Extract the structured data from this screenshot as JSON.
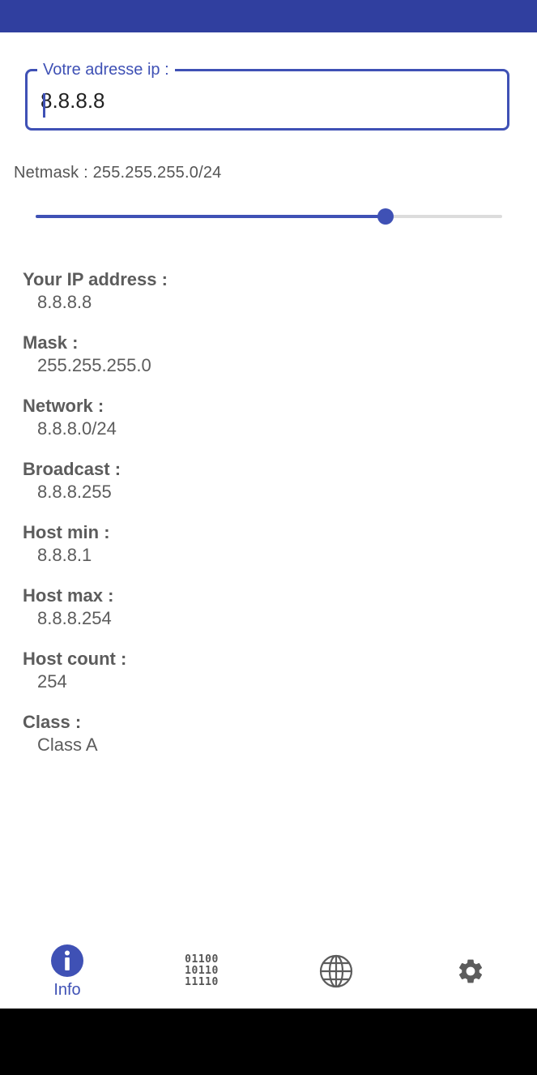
{
  "ip_field": {
    "label": "Votre adresse ip :",
    "value": "8.8.8.8"
  },
  "netmask": {
    "text": "Netmask : 255.255.255.0/24",
    "prefix": 24,
    "min": 0,
    "max": 32
  },
  "info": [
    {
      "label": "Your IP address :",
      "value": "8.8.8.8"
    },
    {
      "label": "Mask :",
      "value": "255.255.255.0"
    },
    {
      "label": "Network :",
      "value": "8.8.8.0/24"
    },
    {
      "label": "Broadcast :",
      "value": "8.8.8.255"
    },
    {
      "label": "Host min :",
      "value": "8.8.8.1"
    },
    {
      "label": "Host max :",
      "value": "8.8.8.254"
    },
    {
      "label": "Host count :",
      "value": "254"
    },
    {
      "label": "Class :",
      "value": "Class A"
    }
  ],
  "nav": {
    "info_label": "Info",
    "binary_icon": {
      "rows": [
        "01100",
        "10110",
        "11110"
      ]
    },
    "icons": [
      "info-icon",
      "binary-icon",
      "globe-icon",
      "gear-icon"
    ]
  },
  "colors": {
    "primary": "#3f51b5",
    "status_bar": "#303f9f",
    "text": "#5c5c5c"
  }
}
